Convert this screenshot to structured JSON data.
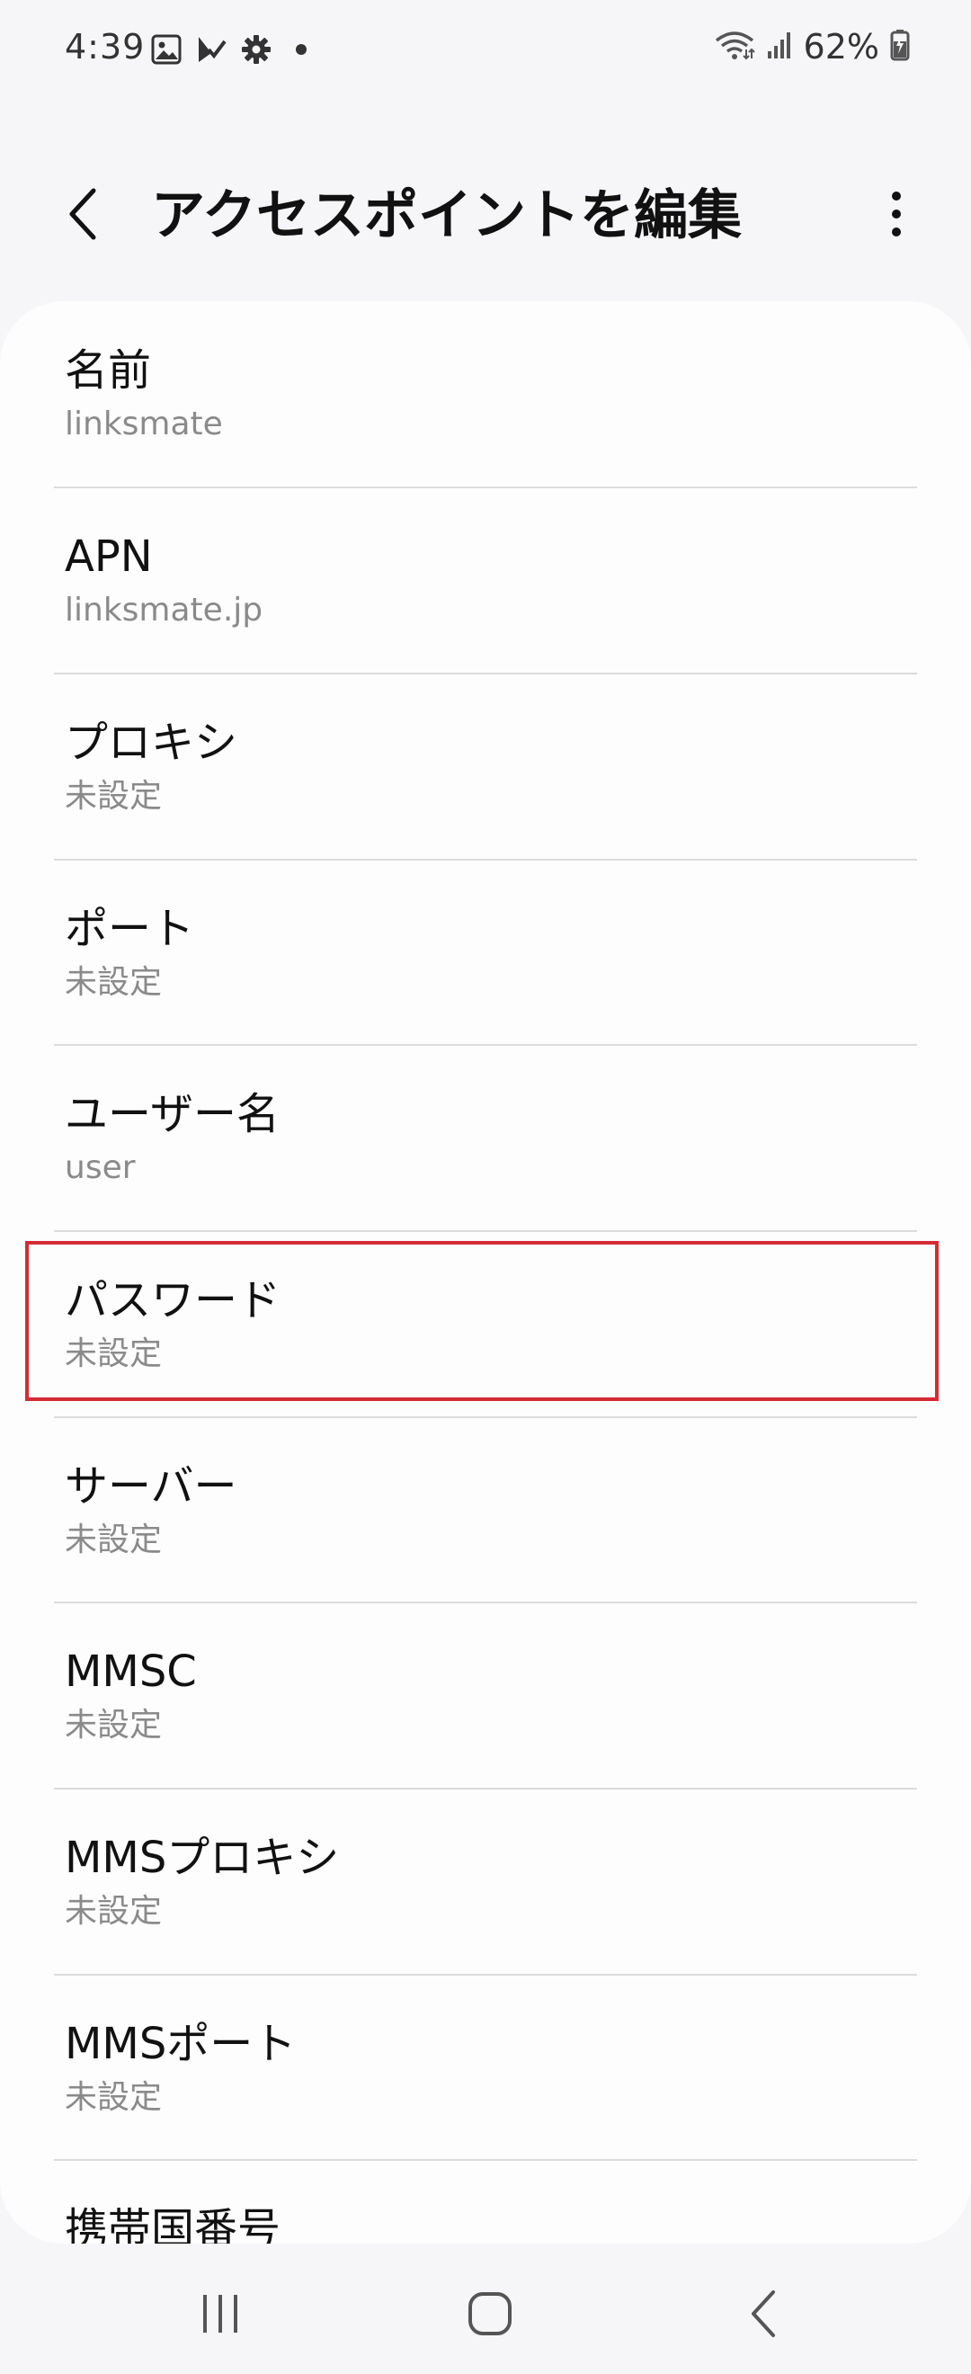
{
  "status_bar": {
    "time": "4:39",
    "battery_percent": "62%",
    "left_icons": [
      "gallery-icon",
      "check-notification-icon",
      "settings-gear-icon",
      "dot-icon"
    ],
    "right_icons": [
      "wifi-icon",
      "signal-icon",
      "battery-charging-icon"
    ]
  },
  "app_bar": {
    "title": "アクセスポイントを編集",
    "back_icon": "chevron-left-icon",
    "more_icon": "more-vertical-icon"
  },
  "list": {
    "items": [
      {
        "title": "名前",
        "value": "linksmate"
      },
      {
        "title": "APN",
        "value": "linksmate.jp"
      },
      {
        "title": "プロキシ",
        "value": "未設定"
      },
      {
        "title": "ポート",
        "value": "未設定"
      },
      {
        "title": "ユーザー名",
        "value": "user"
      },
      {
        "title": "パスワード",
        "value": "未設定"
      },
      {
        "title": "サーバー",
        "value": "未設定"
      },
      {
        "title": "MMSC",
        "value": "未設定"
      },
      {
        "title": "MMSプロキシ",
        "value": "未設定"
      },
      {
        "title": "MMSポート",
        "value": "未設定"
      },
      {
        "title": "携帯国番号",
        "value": ""
      }
    ],
    "highlighted_item": "パスワード"
  },
  "nav_bar": {
    "icons": [
      "recent-apps-icon",
      "home-icon",
      "back-icon"
    ]
  },
  "colors": {
    "background": "#f6f6f8",
    "card": "#fdfdfe",
    "highlight": "#d42b34",
    "secondary_text": "#8a8a8a"
  }
}
